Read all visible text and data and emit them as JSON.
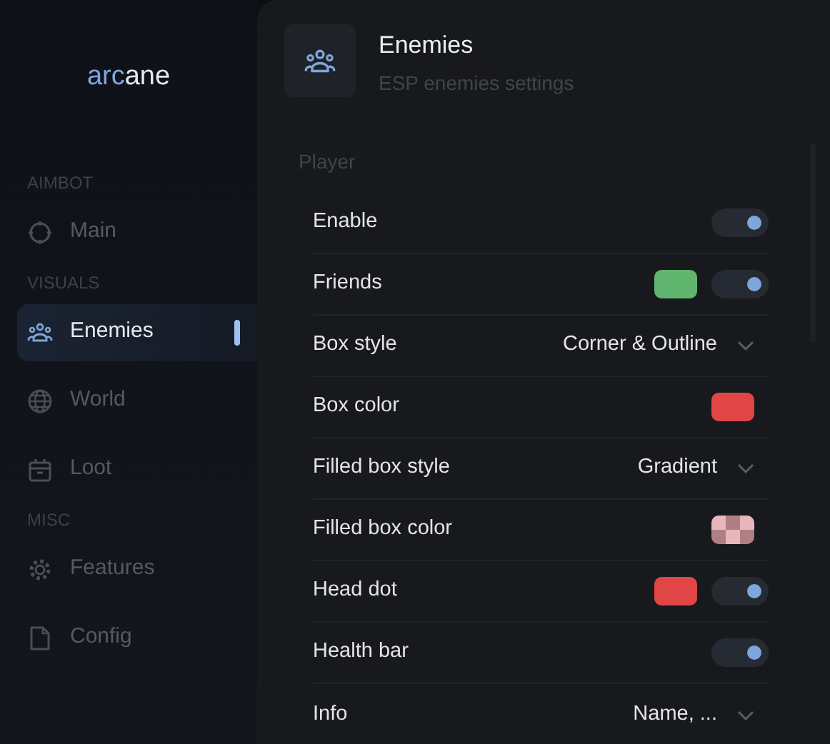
{
  "logo": {
    "accent": "arc",
    "rest": "ane"
  },
  "sidebar": {
    "sections": [
      {
        "title": "AIMBOT",
        "items": [
          {
            "label": "Main",
            "selected": false
          }
        ]
      },
      {
        "title": "VISUALS",
        "items": [
          {
            "label": "Enemies",
            "selected": true
          },
          {
            "label": "World",
            "selected": false
          },
          {
            "label": "Loot",
            "selected": false
          }
        ]
      },
      {
        "title": "MISC",
        "items": [
          {
            "label": "Features",
            "selected": false
          },
          {
            "label": "Config",
            "selected": false
          }
        ]
      }
    ]
  },
  "header": {
    "title": "Enemies",
    "subtitle": "ESP enemies settings"
  },
  "group": {
    "title": "Player",
    "rows": [
      {
        "kind": "toggle",
        "label": "Enable",
        "on": true
      },
      {
        "kind": "color_toggle",
        "label": "Friends",
        "color": "#5fb56e",
        "on": true
      },
      {
        "kind": "select",
        "label": "Box style",
        "value": "Corner & Outline"
      },
      {
        "kind": "color",
        "label": "Box color",
        "color": "#e04646"
      },
      {
        "kind": "select",
        "label": "Filled box style",
        "value": "Gradient"
      },
      {
        "kind": "color",
        "label": "Filled box color",
        "color": "#e7b7bc",
        "checker": true
      },
      {
        "kind": "color_toggle",
        "label": "Head dot",
        "color": "#e04646",
        "on": true
      },
      {
        "kind": "toggle",
        "label": "Health bar",
        "on": true
      },
      {
        "kind": "select",
        "label": "Info",
        "value": "Name, ..."
      }
    ]
  }
}
